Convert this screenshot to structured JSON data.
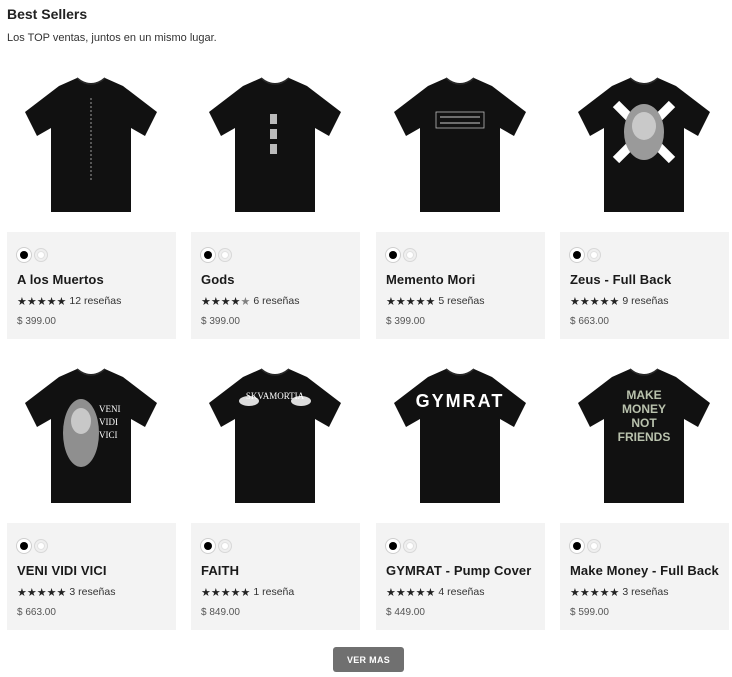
{
  "section": {
    "title": "Best Sellers",
    "subtitle": "Los TOP ventas, juntos en un mismo lugar."
  },
  "products": [
    {
      "name": "A los Muertos",
      "reviews": "12 reseñas",
      "price": "$ 399.00",
      "rating": 5,
      "swatches": [
        "black",
        "white"
      ],
      "print": "a-los-muertos-vertical-text"
    },
    {
      "name": "Gods",
      "reviews": "6 reseñas",
      "price": "$ 399.00",
      "rating": 4.5,
      "swatches": [
        "black",
        "white"
      ],
      "print": "gods-small-statue-images"
    },
    {
      "name": "Memento Mori",
      "reviews": "5 reseñas",
      "price": "$ 399.00",
      "rating": 5,
      "swatches": [
        "black",
        "white"
      ],
      "print": "memento-mori-text-box"
    },
    {
      "name": "Zeus - Full Back",
      "reviews": "9 reseñas",
      "price": "$ 663.00",
      "rating": 5,
      "swatches": [
        "black",
        "white"
      ],
      "print": "zeus-statue-with-x"
    },
    {
      "name": "VENI VIDI VICI",
      "reviews": "3 reseñas",
      "price": "$ 663.00",
      "rating": 5,
      "swatches": [
        "black",
        "white"
      ],
      "print": "veni-vidi-vici-statue"
    },
    {
      "name": "FAITH",
      "reviews": "1 reseña",
      "price": "$ 849.00",
      "rating": 5,
      "swatches": [
        "black",
        "white"
      ],
      "print": "faith-doves"
    },
    {
      "name": "GYMRAT - Pump Cover",
      "reviews": "4 reseñas",
      "price": "$ 449.00",
      "rating": 5,
      "swatches": [
        "black",
        "white"
      ],
      "print": "gymrat-text"
    },
    {
      "name": "Make Money - Full Back",
      "reviews": "3 reseñas",
      "price": "$ 599.00",
      "rating": 5,
      "swatches": [
        "black",
        "white"
      ],
      "print": "make-money-not-friends-text"
    }
  ],
  "prints": {
    "tshirt_color": "#111111",
    "veni": [
      "VENI",
      "VIDI",
      "VICI"
    ],
    "faith": "SKVAMORTIA",
    "gymrat": "GYMRAT",
    "makemoney": [
      "MAKE",
      "MONEY",
      "NOT",
      "FRIENDS"
    ]
  },
  "more_button": {
    "label": "VER MAS"
  },
  "colors": {
    "card_bg": "#f3f3f3",
    "button_bg": "#707070",
    "text": "#1a1a1a"
  }
}
